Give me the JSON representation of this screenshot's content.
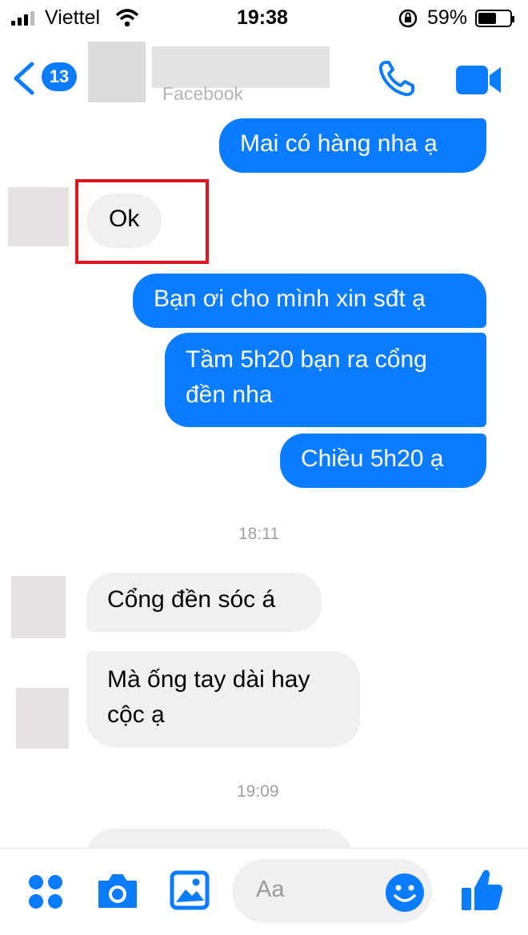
{
  "status_bar": {
    "carrier": "Viettel",
    "time": "19:38",
    "battery_percent": "59%",
    "battery_level": 0.59
  },
  "header": {
    "back_count": "13",
    "subtitle": "Facebook"
  },
  "messages": [
    {
      "side": "out",
      "text": "Mai có hàng nha ạ"
    },
    {
      "side": "in",
      "text": "Ok",
      "highlighted": true
    },
    {
      "side": "out",
      "text": "Bạn ơi cho mình xin sđt ạ"
    },
    {
      "side": "out",
      "line1": "Tầm 5h20 bạn ra cổng",
      "line2": "đền nha"
    },
    {
      "side": "out",
      "text": "Chiều 5h20 ạ"
    },
    {
      "type": "timestamp",
      "text": "18:11"
    },
    {
      "side": "in",
      "text": "Cổng đền sóc á"
    },
    {
      "side": "in",
      "line1": "Mà ống tay dài hay",
      "line2": "cộc ạ"
    },
    {
      "type": "timestamp",
      "text": "19:09"
    }
  ],
  "composer": {
    "placeholder": "Aa"
  },
  "colors": {
    "accent": "#0a7cff",
    "incoming_bubble": "#f0f0f0",
    "highlight_box": "#e0161c"
  },
  "icons": [
    "back-chevron-icon",
    "phone-icon",
    "video-camera-icon",
    "apps-grid-icon",
    "camera-icon",
    "image-icon",
    "emoji-icon",
    "thumbs-up-icon",
    "wifi-icon",
    "signal-icon",
    "battery-icon",
    "orientation-lock-icon"
  ]
}
